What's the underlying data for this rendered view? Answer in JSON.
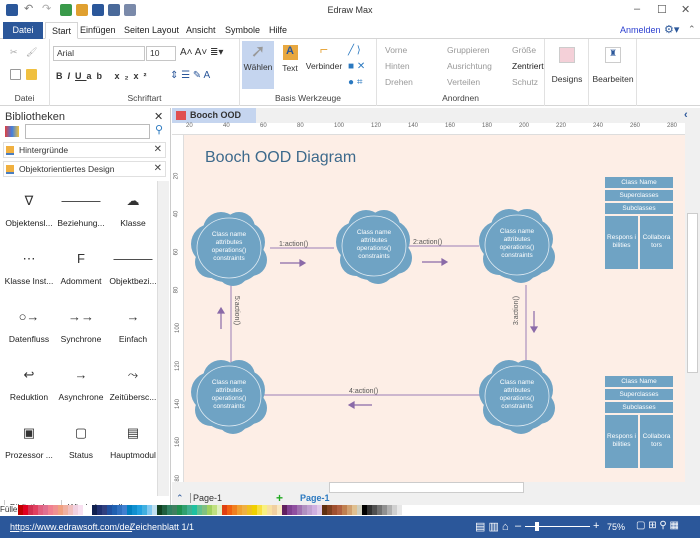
{
  "app": {
    "title": "Edraw Max"
  },
  "menu_tabs": [
    "Datei",
    "Start",
    "Einfügen",
    "Seiten Layout",
    "Ansicht",
    "Symbole",
    "Hilfe"
  ],
  "account": {
    "login": "Anmelden"
  },
  "ribbon": {
    "datei_group": "Datei",
    "font": {
      "family": "Arial",
      "size": "10",
      "group": "Schriftart"
    },
    "tools": {
      "select": "Wählen",
      "text": "Text",
      "connector": "Verbinder",
      "group": "Basis Werkzeuge"
    },
    "arrange": {
      "front": "Vorne",
      "back": "Hinten",
      "rotate": "Drehen",
      "group_btn": "Gruppieren",
      "align": "Ausrichtung",
      "distribute": "Verteilen",
      "size": "Größe",
      "center": "Zentriert",
      "protect": "Schutz",
      "group": "Anordnen"
    },
    "designs": "Designs",
    "edit": "Bearbeiten"
  },
  "libraries": {
    "title": "Bibliotheken",
    "search_placeholder": "",
    "sections": [
      "Hintergründe",
      "Objektorientiertes Design"
    ],
    "shapes": [
      "Objektensl...",
      "Beziehung...",
      "Klasse",
      "Klasse Inst...",
      "Adomment",
      "Objektbezi...",
      "Datenfluss",
      "Synchrone",
      "Einfach",
      "Reduktion",
      "Asynchrone",
      "Zeitübersc...",
      "Prozessor ...",
      "Status",
      "Hauptmodul"
    ],
    "bottom_tabs": [
      "Bibliotheken",
      "Wiederherstellung"
    ]
  },
  "document": {
    "tab": "Booch OOD",
    "ruler_h": [
      "20",
      "40",
      "60",
      "80",
      "100",
      "120",
      "140",
      "160",
      "180",
      "200",
      "220",
      "240",
      "260",
      "280"
    ],
    "ruler_v": [
      "20",
      "40",
      "60",
      "80",
      "100",
      "120",
      "140",
      "160",
      "180"
    ],
    "title": "Booch OOD Diagram",
    "cloud_lines": [
      "Class name",
      "attributes",
      "operations()",
      "constraints"
    ],
    "actions": [
      "1:action()",
      "2:action()",
      "3:action()",
      "4:action()",
      "5:action()"
    ],
    "class_box": {
      "name": "Class Name",
      "super": "Superclasses",
      "sub": "Subclasses",
      "resp": "Respons i bilities",
      "collab": "Collabora tors"
    }
  },
  "pages": {
    "current": "Page-1",
    "tab": "Page-1"
  },
  "palette": {
    "label": "Füller",
    "colors": [
      "#c00000",
      "#e00020",
      "#d03050",
      "#e04060",
      "#e06080",
      "#e07090",
      "#f08090",
      "#f09090",
      "#f0a080",
      "#f0b0a0",
      "#f0c0c0",
      "#f0d0e0",
      "#f8e0f0",
      "#ffffff",
      "#102050",
      "#203070",
      "#304080",
      "#2050a0",
      "#2060b0",
      "#3070c0",
      "#4080d0",
      "#0080c0",
      "#1090d0",
      "#20a0e0",
      "#40b0e0",
      "#80c8f0",
      "#c0e0f0",
      "#104020",
      "#206040",
      "#308060",
      "#408060",
      "#209050",
      "#30a070",
      "#40b090",
      "#20c0a0",
      "#60c090",
      "#80c080",
      "#a0d060",
      "#c0e080",
      "#e0f0c0",
      "#e04010",
      "#f06010",
      "#f08020",
      "#f0a030",
      "#f0b040",
      "#f0c020",
      "#f0d000",
      "#f8e040",
      "#f8f080",
      "#f8e0a0",
      "#f0d0a0",
      "#f8e8c0",
      "#602060",
      "#804090",
      "#9050a0",
      "#a070b0",
      "#b090c0",
      "#c0a0d0",
      "#d0b0e0",
      "#e0c8e8",
      "#603010",
      "#804020",
      "#a05030",
      "#b06040",
      "#c08050",
      "#d0a070",
      "#e0c090",
      "#d0d0c0",
      "#000000",
      "#303030",
      "#505050",
      "#707070",
      "#909090",
      "#b0b0b0",
      "#d0d0d0",
      "#e8e8e8"
    ]
  },
  "status": {
    "url": "https://www.edrawsoft.com/de/",
    "sheet": "Zeichenblatt 1/1",
    "zoom": "75%"
  },
  "colors": {
    "accent": "#2b579a",
    "cloud": "#6fa3c4",
    "canvas": "#fdeee6",
    "connector": "#9a7eb5"
  }
}
